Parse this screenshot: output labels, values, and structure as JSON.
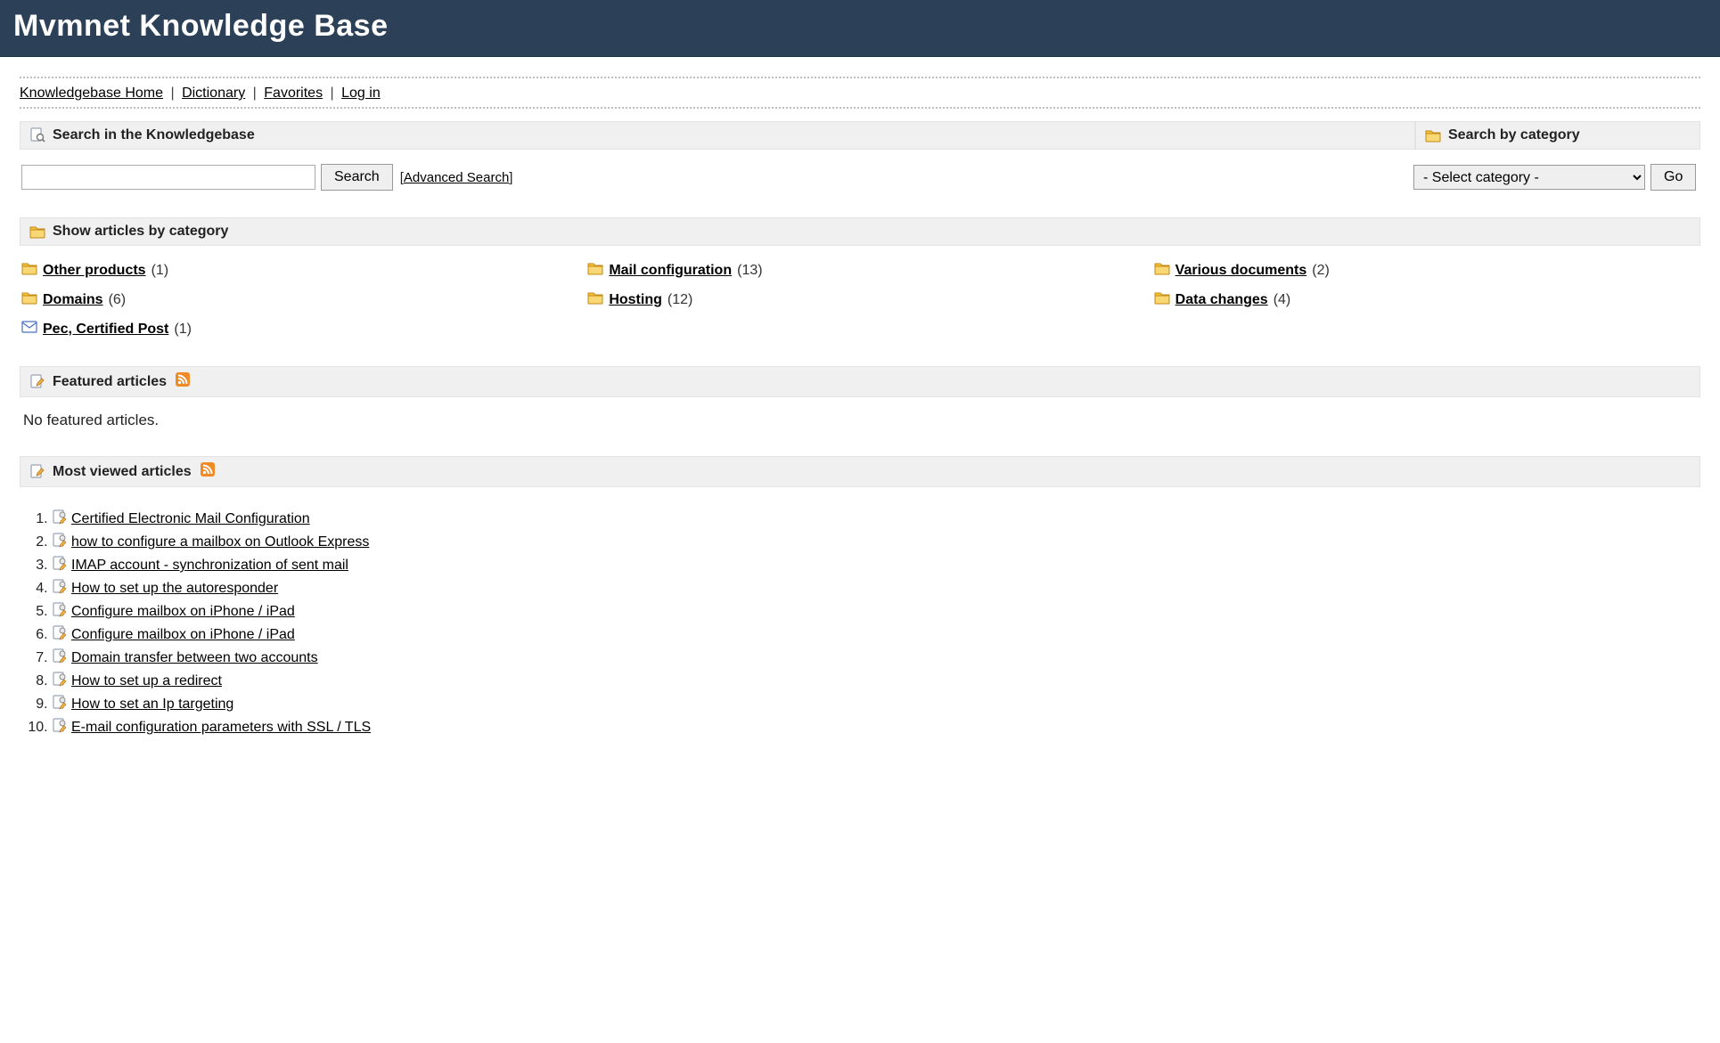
{
  "header": {
    "title": "Mvmnet Knowledge Base"
  },
  "breadcrumb": {
    "home": "Knowledgebase Home",
    "dictionary": "Dictionary",
    "favorites": "Favorites",
    "login": "Log in"
  },
  "search": {
    "title": "Search in the Knowledgebase",
    "button": "Search",
    "advanced": "Advanced Search"
  },
  "searchCategory": {
    "title": "Search by category",
    "placeholder": "- Select category -",
    "go": "Go"
  },
  "categoriesSection": {
    "title": "Show articles by category"
  },
  "categories": [
    {
      "label": "Other products",
      "count": "(1)",
      "icon": "folder"
    },
    {
      "label": "Mail configuration",
      "count": "(13)",
      "icon": "folder"
    },
    {
      "label": "Various documents",
      "count": "(2)",
      "icon": "folder"
    },
    {
      "label": "Domains",
      "count": "(6)",
      "icon": "folder"
    },
    {
      "label": "Hosting",
      "count": "(12)",
      "icon": "folder"
    },
    {
      "label": "Data changes",
      "count": "(4)",
      "icon": "folder"
    },
    {
      "label": "Pec, Certified Post",
      "count": "(1)",
      "icon": "mail"
    }
  ],
  "featured": {
    "title": "Featured articles",
    "empty": "No featured articles."
  },
  "mostViewed": {
    "title": "Most viewed articles",
    "items": [
      "Certified Electronic Mail Configuration",
      "how to configure a mailbox on Outlook Express",
      "IMAP account - synchronization of sent mail",
      "How to set up the autoresponder",
      "Configure mailbox on iPhone / iPad",
      "Configure mailbox on iPhone / iPad",
      "Domain transfer between two accounts",
      "How to set up a redirect",
      "How to set an Ip targeting",
      "E-mail configuration parameters with SSL / TLS"
    ]
  }
}
